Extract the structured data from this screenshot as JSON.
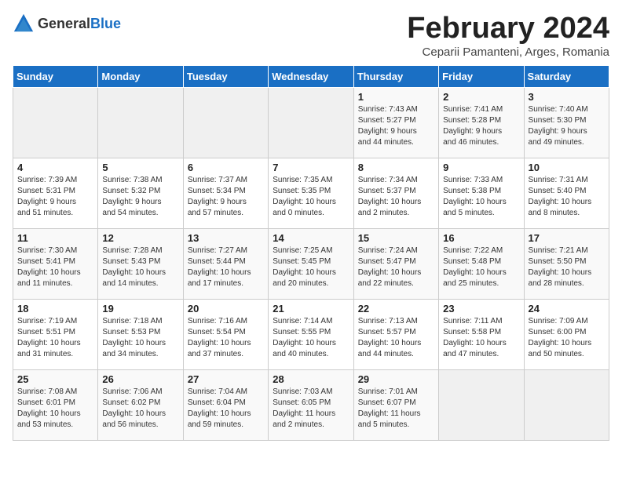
{
  "logo": {
    "general": "General",
    "blue": "Blue"
  },
  "title": "February 2024",
  "subtitle": "Ceparii Pamanteni, Arges, Romania",
  "days_of_week": [
    "Sunday",
    "Monday",
    "Tuesday",
    "Wednesday",
    "Thursday",
    "Friday",
    "Saturday"
  ],
  "weeks": [
    [
      {
        "day": "",
        "info": ""
      },
      {
        "day": "",
        "info": ""
      },
      {
        "day": "",
        "info": ""
      },
      {
        "day": "",
        "info": ""
      },
      {
        "day": "1",
        "info": "Sunrise: 7:43 AM\nSunset: 5:27 PM\nDaylight: 9 hours\nand 44 minutes."
      },
      {
        "day": "2",
        "info": "Sunrise: 7:41 AM\nSunset: 5:28 PM\nDaylight: 9 hours\nand 46 minutes."
      },
      {
        "day": "3",
        "info": "Sunrise: 7:40 AM\nSunset: 5:30 PM\nDaylight: 9 hours\nand 49 minutes."
      }
    ],
    [
      {
        "day": "4",
        "info": "Sunrise: 7:39 AM\nSunset: 5:31 PM\nDaylight: 9 hours\nand 51 minutes."
      },
      {
        "day": "5",
        "info": "Sunrise: 7:38 AM\nSunset: 5:32 PM\nDaylight: 9 hours\nand 54 minutes."
      },
      {
        "day": "6",
        "info": "Sunrise: 7:37 AM\nSunset: 5:34 PM\nDaylight: 9 hours\nand 57 minutes."
      },
      {
        "day": "7",
        "info": "Sunrise: 7:35 AM\nSunset: 5:35 PM\nDaylight: 10 hours\nand 0 minutes."
      },
      {
        "day": "8",
        "info": "Sunrise: 7:34 AM\nSunset: 5:37 PM\nDaylight: 10 hours\nand 2 minutes."
      },
      {
        "day": "9",
        "info": "Sunrise: 7:33 AM\nSunset: 5:38 PM\nDaylight: 10 hours\nand 5 minutes."
      },
      {
        "day": "10",
        "info": "Sunrise: 7:31 AM\nSunset: 5:40 PM\nDaylight: 10 hours\nand 8 minutes."
      }
    ],
    [
      {
        "day": "11",
        "info": "Sunrise: 7:30 AM\nSunset: 5:41 PM\nDaylight: 10 hours\nand 11 minutes."
      },
      {
        "day": "12",
        "info": "Sunrise: 7:28 AM\nSunset: 5:43 PM\nDaylight: 10 hours\nand 14 minutes."
      },
      {
        "day": "13",
        "info": "Sunrise: 7:27 AM\nSunset: 5:44 PM\nDaylight: 10 hours\nand 17 minutes."
      },
      {
        "day": "14",
        "info": "Sunrise: 7:25 AM\nSunset: 5:45 PM\nDaylight: 10 hours\nand 20 minutes."
      },
      {
        "day": "15",
        "info": "Sunrise: 7:24 AM\nSunset: 5:47 PM\nDaylight: 10 hours\nand 22 minutes."
      },
      {
        "day": "16",
        "info": "Sunrise: 7:22 AM\nSunset: 5:48 PM\nDaylight: 10 hours\nand 25 minutes."
      },
      {
        "day": "17",
        "info": "Sunrise: 7:21 AM\nSunset: 5:50 PM\nDaylight: 10 hours\nand 28 minutes."
      }
    ],
    [
      {
        "day": "18",
        "info": "Sunrise: 7:19 AM\nSunset: 5:51 PM\nDaylight: 10 hours\nand 31 minutes."
      },
      {
        "day": "19",
        "info": "Sunrise: 7:18 AM\nSunset: 5:53 PM\nDaylight: 10 hours\nand 34 minutes."
      },
      {
        "day": "20",
        "info": "Sunrise: 7:16 AM\nSunset: 5:54 PM\nDaylight: 10 hours\nand 37 minutes."
      },
      {
        "day": "21",
        "info": "Sunrise: 7:14 AM\nSunset: 5:55 PM\nDaylight: 10 hours\nand 40 minutes."
      },
      {
        "day": "22",
        "info": "Sunrise: 7:13 AM\nSunset: 5:57 PM\nDaylight: 10 hours\nand 44 minutes."
      },
      {
        "day": "23",
        "info": "Sunrise: 7:11 AM\nSunset: 5:58 PM\nDaylight: 10 hours\nand 47 minutes."
      },
      {
        "day": "24",
        "info": "Sunrise: 7:09 AM\nSunset: 6:00 PM\nDaylight: 10 hours\nand 50 minutes."
      }
    ],
    [
      {
        "day": "25",
        "info": "Sunrise: 7:08 AM\nSunset: 6:01 PM\nDaylight: 10 hours\nand 53 minutes."
      },
      {
        "day": "26",
        "info": "Sunrise: 7:06 AM\nSunset: 6:02 PM\nDaylight: 10 hours\nand 56 minutes."
      },
      {
        "day": "27",
        "info": "Sunrise: 7:04 AM\nSunset: 6:04 PM\nDaylight: 10 hours\nand 59 minutes."
      },
      {
        "day": "28",
        "info": "Sunrise: 7:03 AM\nSunset: 6:05 PM\nDaylight: 11 hours\nand 2 minutes."
      },
      {
        "day": "29",
        "info": "Sunrise: 7:01 AM\nSunset: 6:07 PM\nDaylight: 11 hours\nand 5 minutes."
      },
      {
        "day": "",
        "info": ""
      },
      {
        "day": "",
        "info": ""
      }
    ]
  ]
}
